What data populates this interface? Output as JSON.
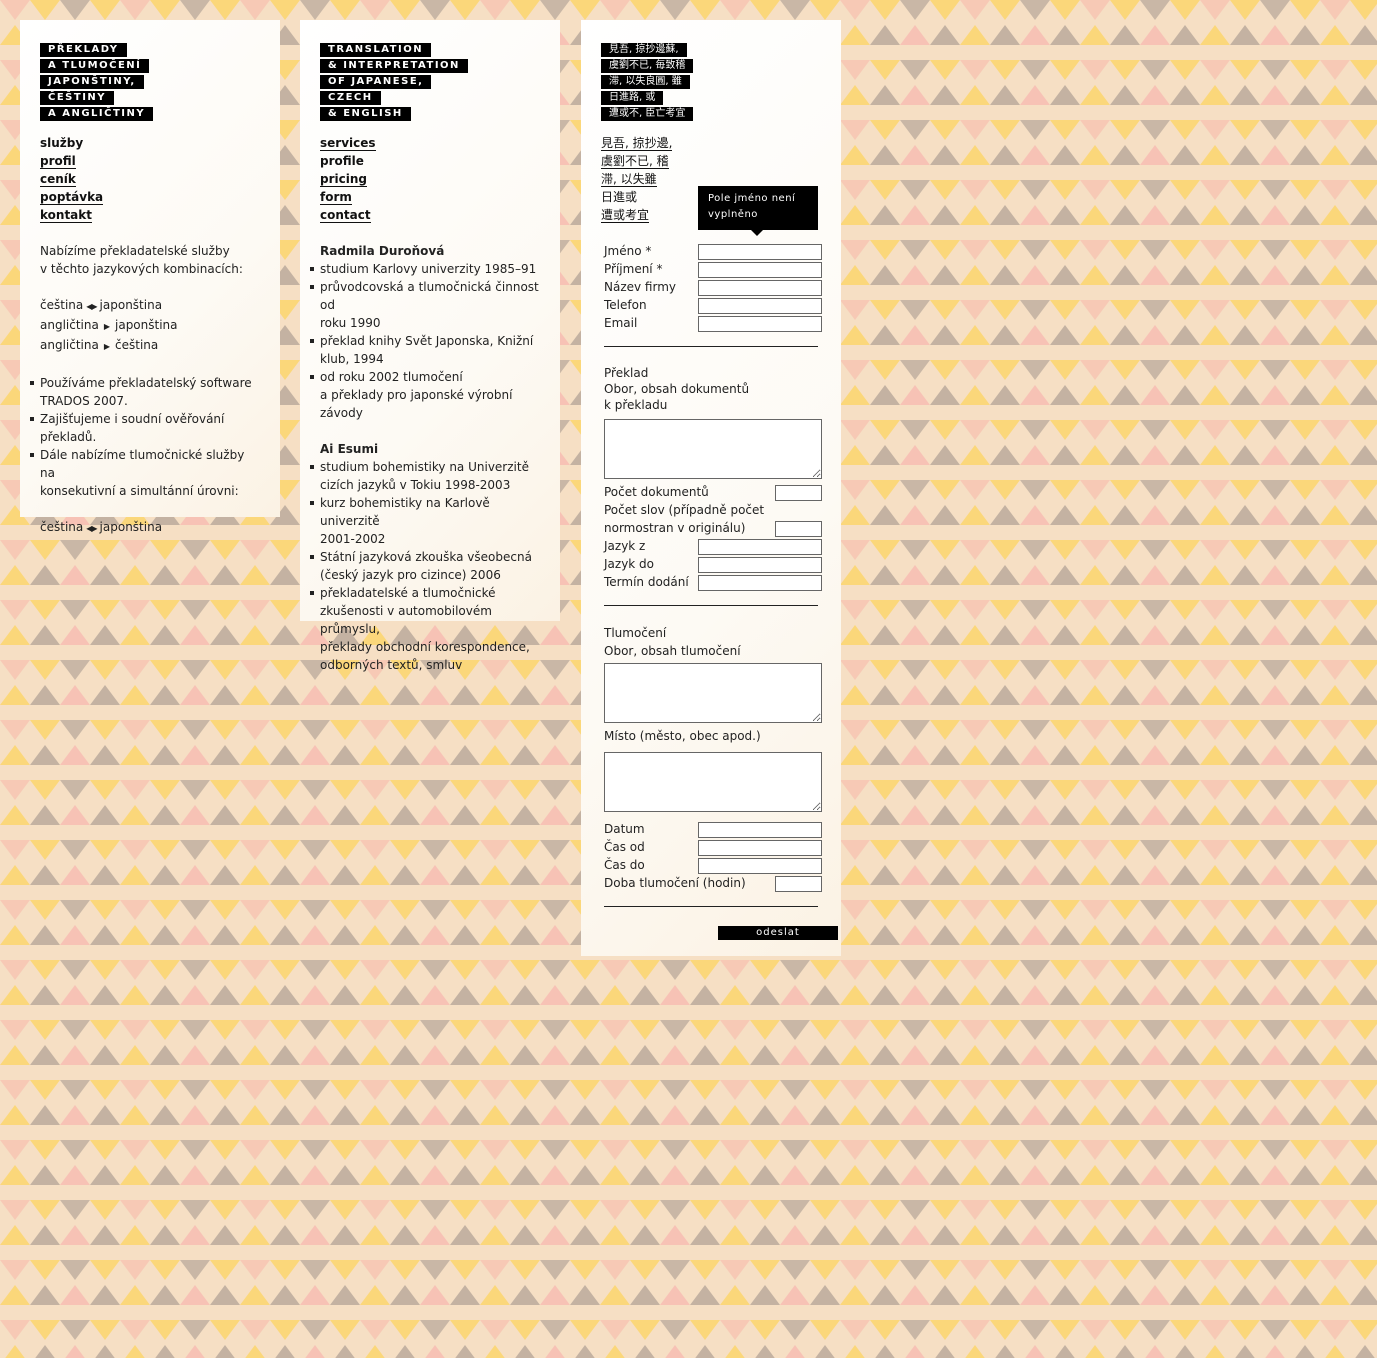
{
  "panel_cz": {
    "logo": [
      "PŘEKLADY",
      "A TLUMOČENÍ",
      "JAPONŠTINY,",
      "ČEŠTINY",
      "A ANGLIČTINY"
    ],
    "nav": [
      "služby",
      "profil",
      "ceník",
      "poptávka",
      "kontakt"
    ],
    "intro": [
      "Nabízíme překladatelské služby",
      "v těchto jazykových kombinacích:"
    ],
    "pairs": [
      {
        "from": "čeština",
        "arrow": "◀▶",
        "to": "japonština"
      },
      {
        "from": "angličtina",
        "arrow": "▶",
        "to": "japonština"
      },
      {
        "from": "angličtina",
        "arrow": "▶",
        "to": "čeština"
      }
    ],
    "bullets": [
      [
        "Používáme překladatelský software",
        "TRADOS 2007."
      ],
      [
        "Zajišťujeme i soudní ověřování překladů."
      ],
      [
        "Dále nabízíme tlumočnické služby na",
        "konsekutivní a simultánní úrovni:"
      ]
    ],
    "interp_pair": {
      "from": "čeština",
      "arrow": "◀▶",
      "to": "japonština"
    }
  },
  "panel_en": {
    "logo": [
      "TRANSLATION",
      "& INTERPRETATION",
      "OF JAPANESE,",
      "CZECH",
      "& ENGLISH"
    ],
    "nav": [
      "services",
      "profile",
      "pricing",
      "form",
      "contact"
    ],
    "person1": {
      "name": "Radmila Duroňová",
      "items": [
        [
          "studium Karlovy univerzity 1985–91"
        ],
        [
          "průvodcovská a tlumočnická činnost od",
          "roku 1990"
        ],
        [
          "překlad knihy Svět Japonska, Knižní",
          "klub, 1994"
        ],
        [
          "od roku 2002 tlumočení",
          "a překlady pro japonské výrobní závody"
        ]
      ]
    },
    "person2": {
      "name": "Ai Esumi",
      "items": [
        [
          "studium bohemistiky na Univerzitě",
          "cizích jazyků v Tokiu 1998-2003"
        ],
        [
          "kurz bohemistiky na Karlově univerzitě",
          "2001-2002"
        ],
        [
          "Státní jazyková zkouška všeobecná",
          "(český jazyk pro cizince) 2006"
        ],
        [
          "překladatelské a tlumočnické",
          "zkušenosti v automobilovém průmyslu,",
          "překlady obchodní korespondence,",
          "odborných textů, smluv"
        ]
      ]
    }
  },
  "panel_jp": {
    "logo": [
      "見吾, 掠抄邊蘇,",
      "虞劉不已, 毎致稽",
      "滞, 以失良圓, 雖",
      "日進路, 或",
      "遭或不, 臣亡考宜"
    ],
    "nav": [
      "見吾, 掠抄邊,",
      "虞劉不已, 稽",
      "滞, 以失雖",
      "日進或",
      "遭或考宜"
    ],
    "tooltip": "Pole jméno není vyplněno",
    "contact_fields": [
      "Jméno *",
      "Příjmení *",
      "Název firmy",
      "Telefon",
      "Email"
    ],
    "translation": {
      "heading": "Překlad",
      "area_label": [
        "Obor, obsah dokumentů",
        "k překladu"
      ],
      "doc_count": "Počet dokumentů",
      "word_count": [
        "Počet slov (případně počet",
        "normostran v originálu)"
      ],
      "fields": [
        "Jazyk z",
        "Jazyk do",
        "Termín dodání"
      ]
    },
    "interpreting": {
      "heading": "Tlumočení",
      "area_label": "Obor, obsah tlumočení",
      "place_label": "Místo (město, obec apod.)",
      "fields": [
        "Datum",
        "Čas od",
        "Čas do"
      ],
      "hours": "Doba tlumočení (hodin)"
    },
    "submit": "odeslat"
  }
}
